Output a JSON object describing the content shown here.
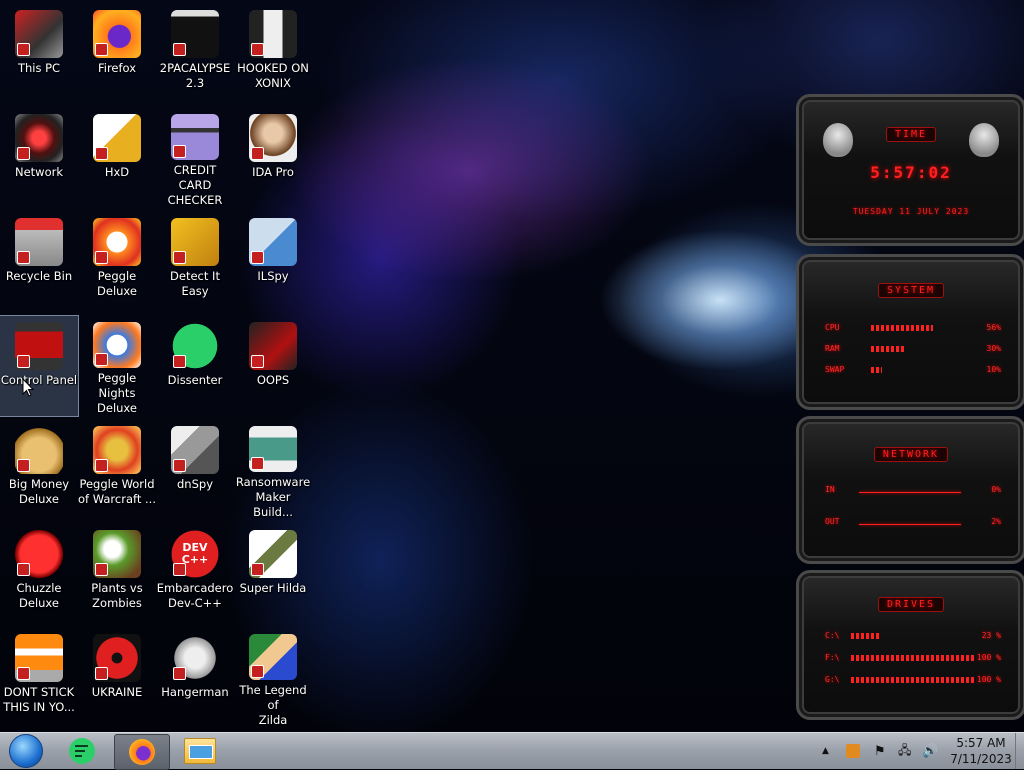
{
  "desktop_icons": [
    {
      "label": "This PC",
      "icon": "this-pc-icon"
    },
    {
      "label": "Firefox",
      "icon": "firefox-icon"
    },
    {
      "label": "2PACALYPSE\n2.3",
      "icon": "terminal-icon"
    },
    {
      "label": "HOOKED ON\nXONIX",
      "icon": "xonix-game-icon"
    },
    {
      "label": "Network",
      "icon": "network-icon"
    },
    {
      "label": "HxD",
      "icon": "hxd-icon"
    },
    {
      "label": "CREDIT CARD\nCHECKER",
      "icon": "credit-card-icon"
    },
    {
      "label": "IDA Pro",
      "icon": "ida-pro-icon"
    },
    {
      "label": "Recycle Bin",
      "icon": "recycle-bin-icon"
    },
    {
      "label": "Peggle Deluxe",
      "icon": "peggle-icon"
    },
    {
      "label": "Detect It Easy",
      "icon": "detect-it-easy-icon"
    },
    {
      "label": "ILSpy",
      "icon": "ilspy-icon"
    },
    {
      "label": "Control Panel",
      "icon": "control-panel-icon"
    },
    {
      "label": "Peggle Nights\nDeluxe",
      "icon": "peggle-nights-icon"
    },
    {
      "label": "Dissenter",
      "icon": "dissenter-icon"
    },
    {
      "label": "OOPS",
      "icon": "oops-icon"
    },
    {
      "label": "Big Money\nDeluxe",
      "icon": "money-bag-icon"
    },
    {
      "label": "Peggle World\nof Warcraft ...",
      "icon": "peggle-wow-icon"
    },
    {
      "label": "dnSpy",
      "icon": "dnspy-icon"
    },
    {
      "label": "Ransomware\nMaker Build...",
      "icon": "ransomware-maker-icon"
    },
    {
      "label": "Chuzzle\nDeluxe",
      "icon": "chuzzle-icon"
    },
    {
      "label": "Plants vs\nZombies",
      "icon": "plants-vs-zombies-icon"
    },
    {
      "label": "Embarcadero\nDev-C++",
      "icon": "devcpp-icon"
    },
    {
      "label": "Super Hilda",
      "icon": "super-hilda-icon"
    },
    {
      "label": "DONT STICK\nTHIS IN YO...",
      "icon": "traffic-cone-icon"
    },
    {
      "label": "UKRAINE",
      "icon": "radiation-icon"
    },
    {
      "label": "Hangerman",
      "icon": "hangerman-icon"
    },
    {
      "label": "The Legend of\nZilda",
      "icon": "zilda-icon"
    }
  ],
  "devcpp_badge": "DEV\nC++",
  "gadgets": {
    "time": {
      "title": "TIME",
      "clock": "5:57:02",
      "date": "TUESDAY 11 JULY 2023"
    },
    "system": {
      "title": "SYSTEM",
      "rows": [
        {
          "name": "CPU",
          "value": "56%",
          "level": 0.56
        },
        {
          "name": "RAM",
          "value": "30%",
          "level": 0.3
        },
        {
          "name": "SWAP",
          "value": "10%",
          "level": 0.1
        }
      ]
    },
    "network": {
      "title": "NETWORK",
      "rows": [
        {
          "name": "IN",
          "value": "0%"
        },
        {
          "name": "OUT",
          "value": "2%"
        }
      ]
    },
    "drives": {
      "title": "DRIVES",
      "rows": [
        {
          "name": "C:\\",
          "value": "23 %",
          "level": 0.23
        },
        {
          "name": "F:\\",
          "value": "100 %",
          "level": 1.0
        },
        {
          "name": "G:\\",
          "value": "100 %",
          "level": 1.0
        }
      ]
    }
  },
  "taskbar": {
    "pinned": [
      "start-orb",
      "dissenter",
      "firefox",
      "file-explorer"
    ],
    "clock_time": "5:57 AM",
    "clock_date": "7/11/2023"
  },
  "colors": {
    "gadget_red": "#ff2020",
    "taskbar": "#a0a6ae",
    "selection": "#8898b0"
  }
}
